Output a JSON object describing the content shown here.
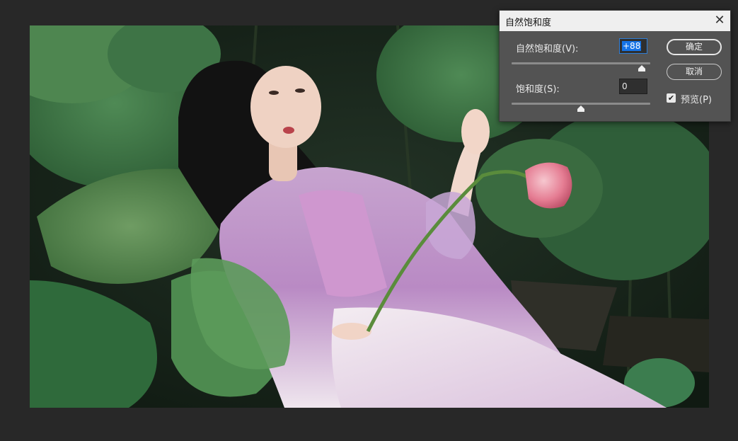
{
  "dialog": {
    "title": "自然饱和度",
    "close_icon": "close-icon",
    "vibrance": {
      "label": "自然饱和度(V):",
      "value": "+88",
      "level": 88,
      "min": -100,
      "max": 100
    },
    "saturation": {
      "label": "饱和度(S):",
      "value": "0",
      "level": 0,
      "min": -100,
      "max": 100
    },
    "ok_label": "确定",
    "cancel_label": "取消",
    "preview": {
      "label": "预览(P)",
      "checked": true
    }
  },
  "colors": {
    "workspace": "#282828",
    "dialog_bg": "#535353",
    "titlebar_bg": "#efefef",
    "focus_highlight": "#1573e6"
  }
}
